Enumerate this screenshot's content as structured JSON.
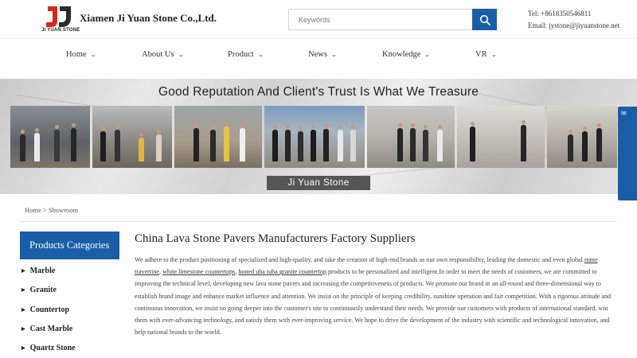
{
  "header": {
    "logo_caption": "JI YUAN STONE",
    "company_name": "Xiamen Ji Yuan Stone Co.,Ltd.",
    "search_placeholder": "Keywords",
    "tel": "Tel: +8618350546811",
    "email": "Email: jystone@jiyuanstone.net"
  },
  "nav": {
    "items": [
      {
        "label": "Home"
      },
      {
        "label": "About Us"
      },
      {
        "label": "Product"
      },
      {
        "label": "News"
      },
      {
        "label": "Knowledge"
      },
      {
        "label": "VR"
      }
    ]
  },
  "banner": {
    "title": "Good Reputation And Client's Trust Is What We Treasure",
    "label": "Ji Yuan Stone"
  },
  "breadcrumb": {
    "home": "Home",
    "separator": ">",
    "current": "Showroom"
  },
  "sidebar": {
    "heading": "Products Categories",
    "items": [
      {
        "label": "Marble"
      },
      {
        "label": "Granite"
      },
      {
        "label": "Countertop"
      },
      {
        "label": "Cast Marble"
      },
      {
        "label": "Quartz Stone"
      }
    ]
  },
  "content": {
    "title": "China Lava Stone Pavers Manufacturers Factory Suppliers",
    "p_start": "We adhere to the product positioning of specialized and high-quality, and take the creation of high-end brands as our own responsibility, leading the domestic and even global ",
    "link1": "rome travertine",
    "sep1": ", ",
    "link2": "white limestone countertops",
    "sep2": ", ",
    "link3": "honed uba tuba granite countertop",
    "p_end": " products to be personalized and intelligent.In order to meet the needs of customers, we are committed to improving the technical level, developing new lava stone pavers and increasing the competitiveness of products. We promote our brand in an all-round and three-dimensional way to establish brand image and enhance market influence and attention. We insist on the principle of keeping credibility, sunshine operation and fair competition. With a rigorous attitude and continuous innovation, we insist on going deeper into the customer's site to continuously understand their needs. We provide our customers with products of international standard, win them with ever-advancing technology, and satisfy them with ever-improving service. We hope to drive the development of the industry with scientific and technological innovation, and help national brands to the world."
  },
  "colors": {
    "brand_blue": "#1a5ea8",
    "logo_red": "#d42a1e",
    "logo_dark": "#2b2b2b"
  },
  "icons": {
    "search": "search-icon",
    "nav_chevron": "chevron-down-icon",
    "category_arrow": "triangle-right-icon"
  }
}
